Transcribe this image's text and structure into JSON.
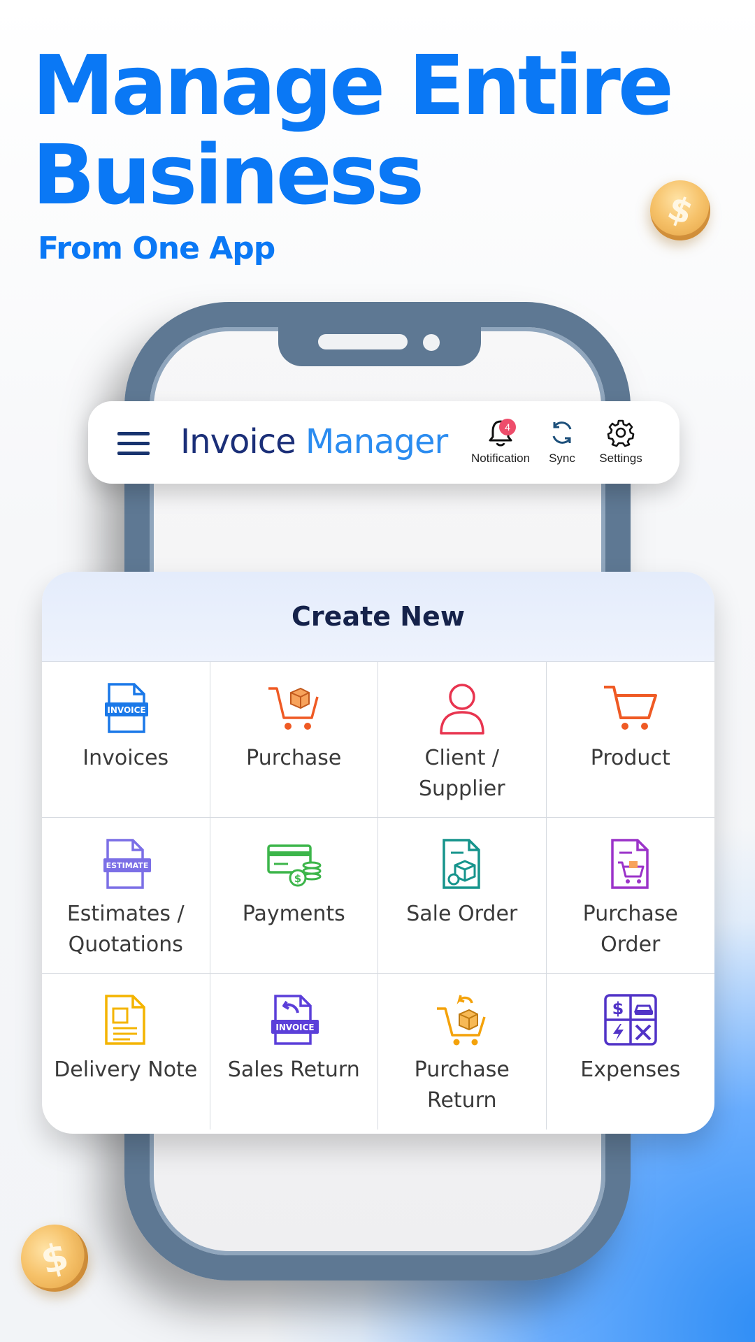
{
  "headline": {
    "line1": "Manage Entire",
    "line2": "Business",
    "sub": "From One App"
  },
  "coins": {
    "symbol": "$"
  },
  "appbar": {
    "title_part1": "Invoice",
    "title_part2": "Manager",
    "notification": {
      "label": "Notification",
      "badge": "4"
    },
    "sync": {
      "label": "Sync"
    },
    "settings": {
      "label": "Settings"
    }
  },
  "create_new": {
    "title": "Create New",
    "items": [
      {
        "label": "Invoices",
        "icon": "invoice-icon",
        "icon_text": "INVOICE"
      },
      {
        "label": "Purchase",
        "icon": "purchase-cart-icon"
      },
      {
        "label": "Client /\nSupplier",
        "icon": "user-icon"
      },
      {
        "label": "Product",
        "icon": "cart-icon"
      },
      {
        "label": "Estimates /\nQuotations",
        "icon": "estimate-icon",
        "icon_text": "ESTIMATE"
      },
      {
        "label": "Payments",
        "icon": "payments-icon"
      },
      {
        "label": "Sale Order",
        "icon": "sale-order-icon"
      },
      {
        "label": "Purchase\nOrder",
        "icon": "purchase-order-icon"
      },
      {
        "label": "Delivery Note",
        "icon": "delivery-note-icon"
      },
      {
        "label": "Sales Return",
        "icon": "sales-return-icon",
        "icon_text": "INVOICE"
      },
      {
        "label": "Purchase\nReturn",
        "icon": "purchase-return-icon"
      },
      {
        "label": "Expenses",
        "icon": "expenses-icon"
      }
    ]
  },
  "colors": {
    "brand_blue": "#0a78f5",
    "title_dark": "#1b2f78",
    "title_light": "#2b8cf0",
    "badge": "#ee4d6b"
  }
}
